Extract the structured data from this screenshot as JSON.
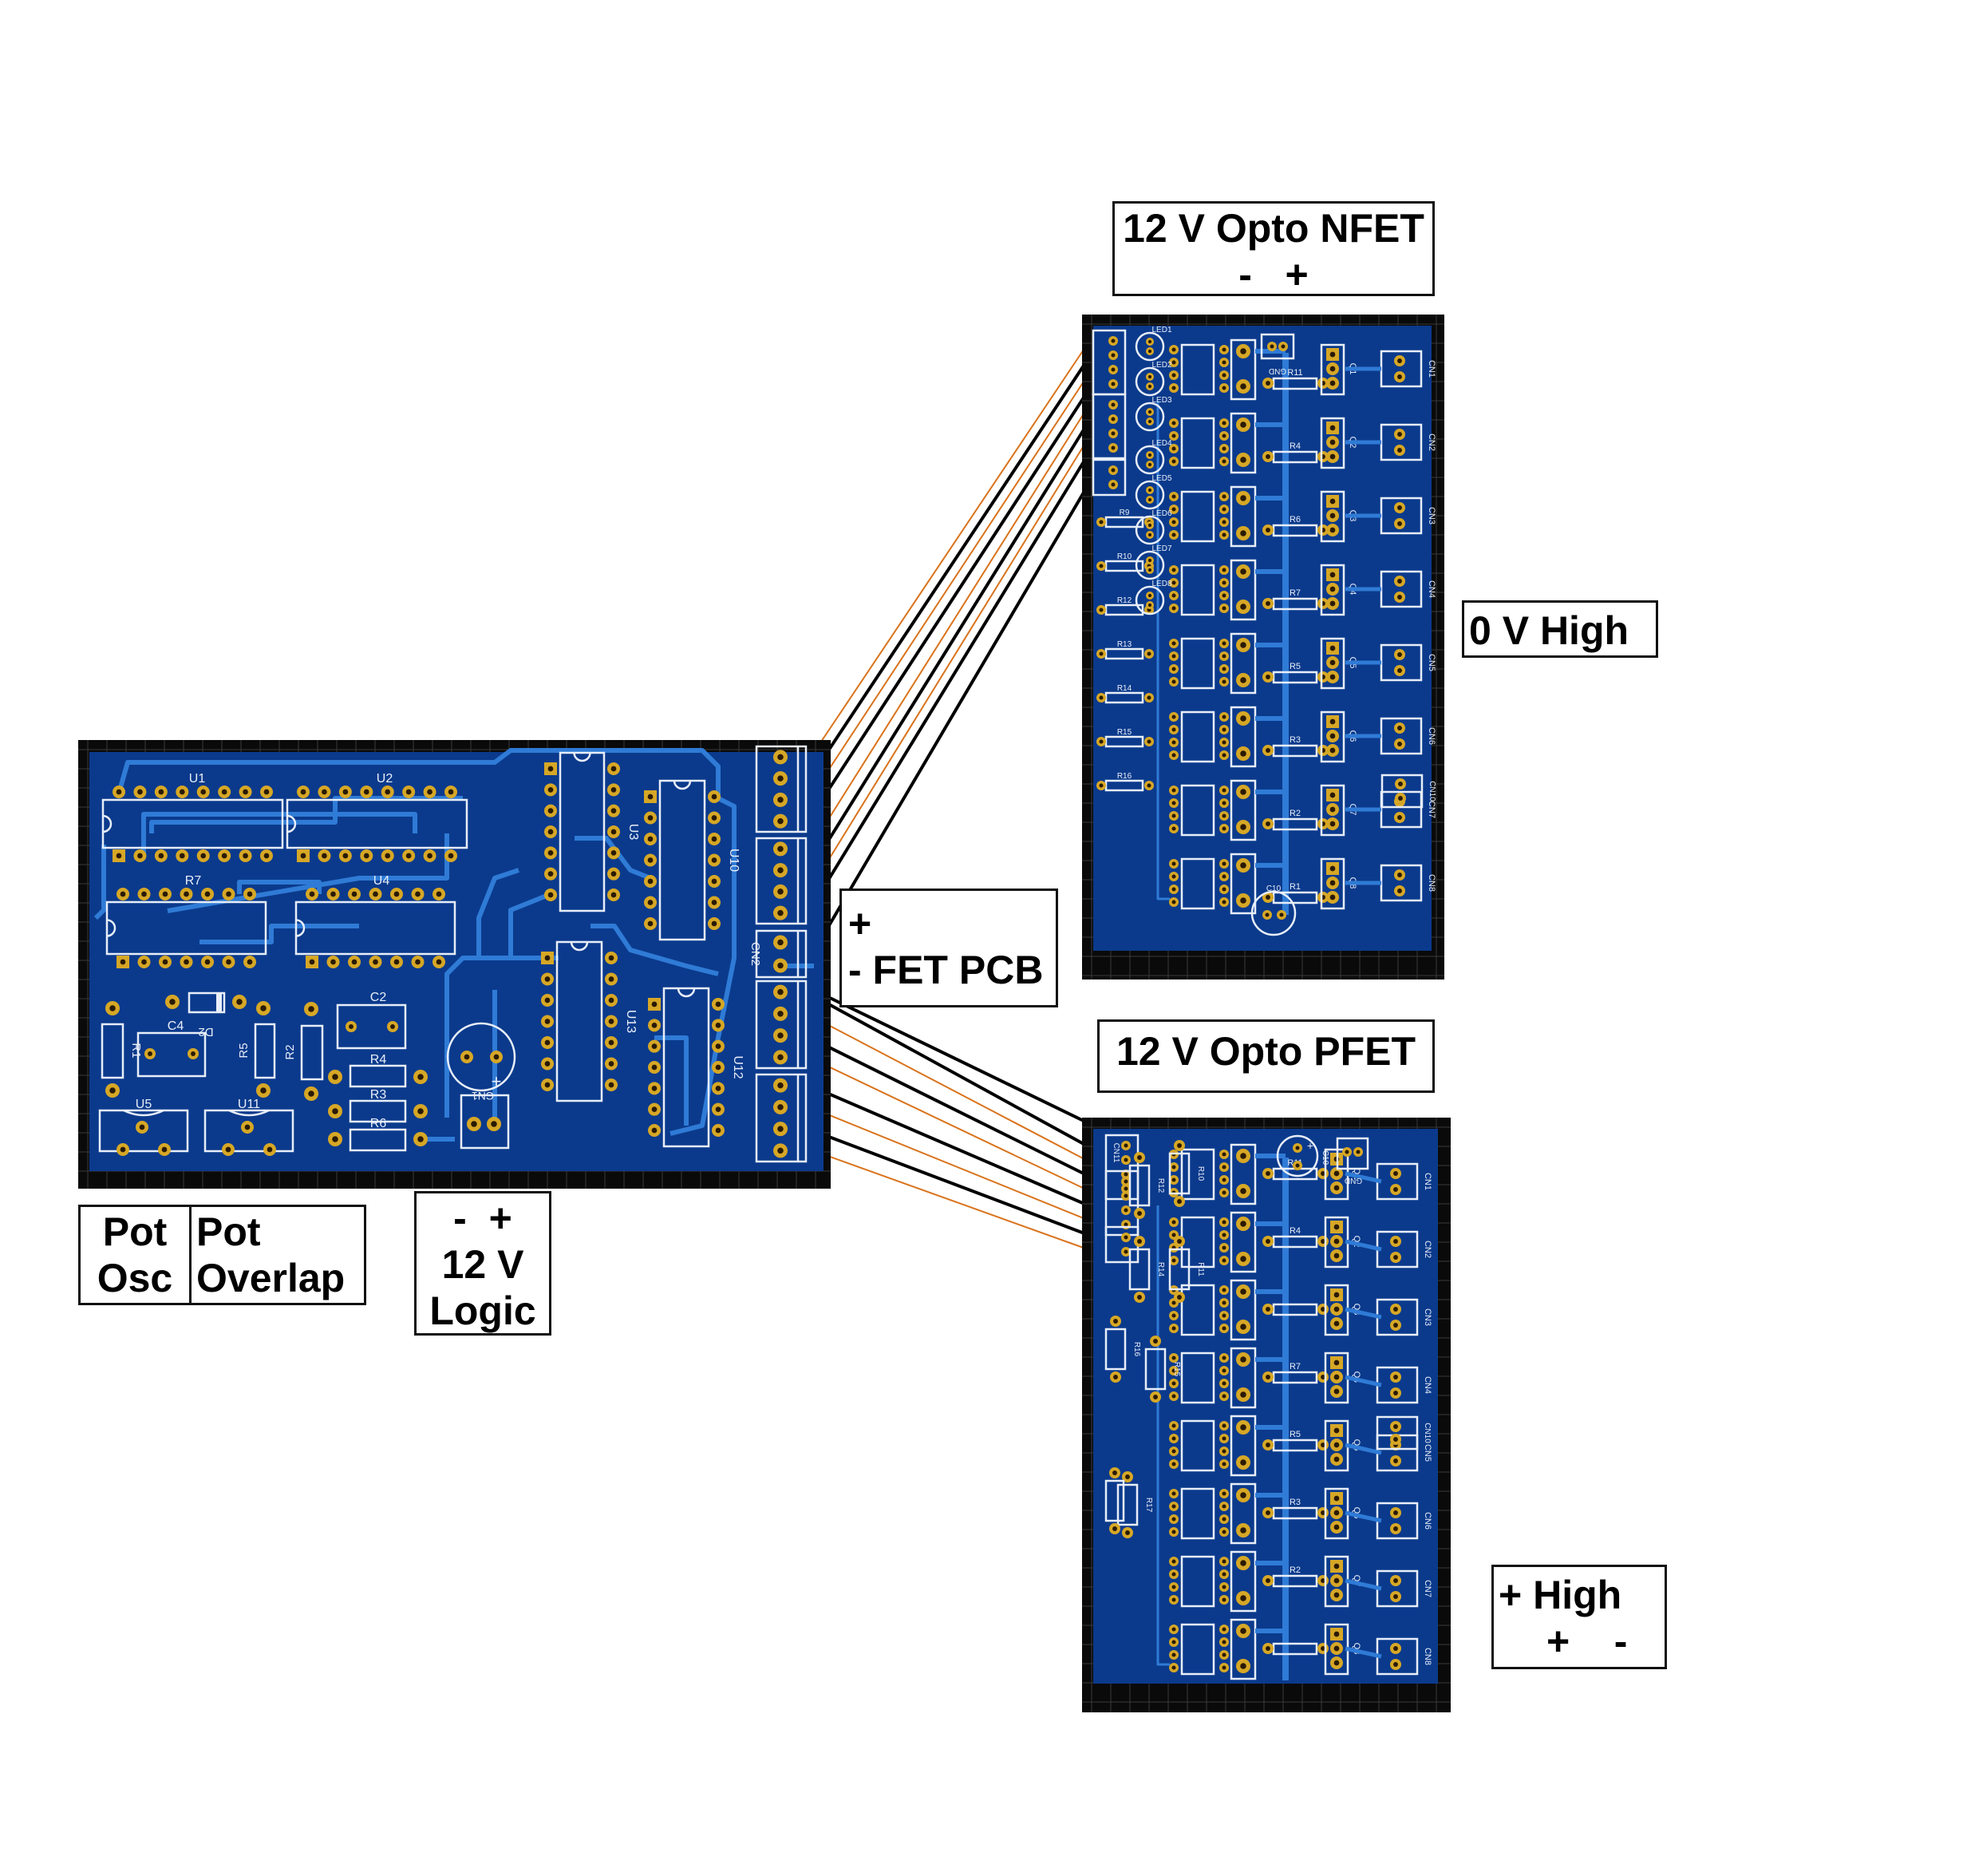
{
  "labels": {
    "nfet": {
      "line1": "12 V Opto NFET",
      "line2": "-   +"
    },
    "zero_high": "0 V High",
    "fet_pcb": {
      "line1": "+",
      "line2": "- FET PCB"
    },
    "pfet": "12 V Opto PFET",
    "plus_high": {
      "line1": "+ High",
      "line2": "+    -"
    },
    "pot_osc": {
      "line1": "Pot",
      "line2": "Osc"
    },
    "pot_overlap": {
      "line1": "Pot",
      "line2": "Overlap"
    },
    "logic": {
      "line1": "-  +",
      "line2": "12 V",
      "line3": "Logic"
    }
  },
  "main_board": {
    "components": [
      "U1",
      "U2",
      "U3",
      "U10",
      "R7",
      "U4",
      "U13",
      "U12",
      "CN2",
      "D2",
      "C4",
      "R1",
      "R5",
      "R2",
      "C2",
      "R4",
      "R3",
      "R6",
      "CN1",
      "U5",
      "U11"
    ]
  },
  "nfet_board": {
    "leds": [
      "LED1",
      "LED2",
      "LED3",
      "LED4",
      "LED5",
      "LED6",
      "LED7",
      "LED8"
    ],
    "row_resistors": [
      "R11",
      "R4",
      "R6",
      "R7",
      "R5",
      "R3",
      "R2",
      "R1"
    ],
    "left_resistors": [
      "R9",
      "R10",
      "R12",
      "R13",
      "R14",
      "R15",
      "R16"
    ],
    "fets": [
      "Q1",
      "Q2",
      "Q3",
      "Q4",
      "Q5",
      "Q6",
      "Q7",
      "Q8"
    ],
    "connectors": [
      "CN1",
      "CN2",
      "CN3",
      "CN4",
      "CN5",
      "CN6",
      "CN7",
      "CN8"
    ],
    "extra_connector": "CN10",
    "gnd": "GND",
    "cap": "C10"
  },
  "pfet_board": {
    "row_resistors": [
      "R11",
      "R4",
      "",
      "R7",
      "R5",
      "R3",
      "R2",
      ""
    ],
    "left_resistors": [
      "R12",
      "R10",
      "R14",
      "R11",
      "R16",
      "R15",
      "R17"
    ],
    "fets": [
      "Q1",
      "Q2",
      "Q3",
      "Q4",
      "Q5",
      "Q6",
      "Q7",
      "Q8"
    ],
    "connectors": [
      "CN1",
      "CN2",
      "CN3",
      "CN4",
      "CN5",
      "CN6",
      "CN7",
      "CN8"
    ],
    "extra_connector": "CN10",
    "input_connector": "CN11",
    "gnd": "GND",
    "cap": "C10"
  },
  "colors": {
    "board": "#0b3a8c",
    "trace": "#2f7bd6",
    "pad": "#d6a726",
    "frame": "#0a0a0a",
    "wire_black": "#000000",
    "wire_orange": "#d9731c"
  }
}
